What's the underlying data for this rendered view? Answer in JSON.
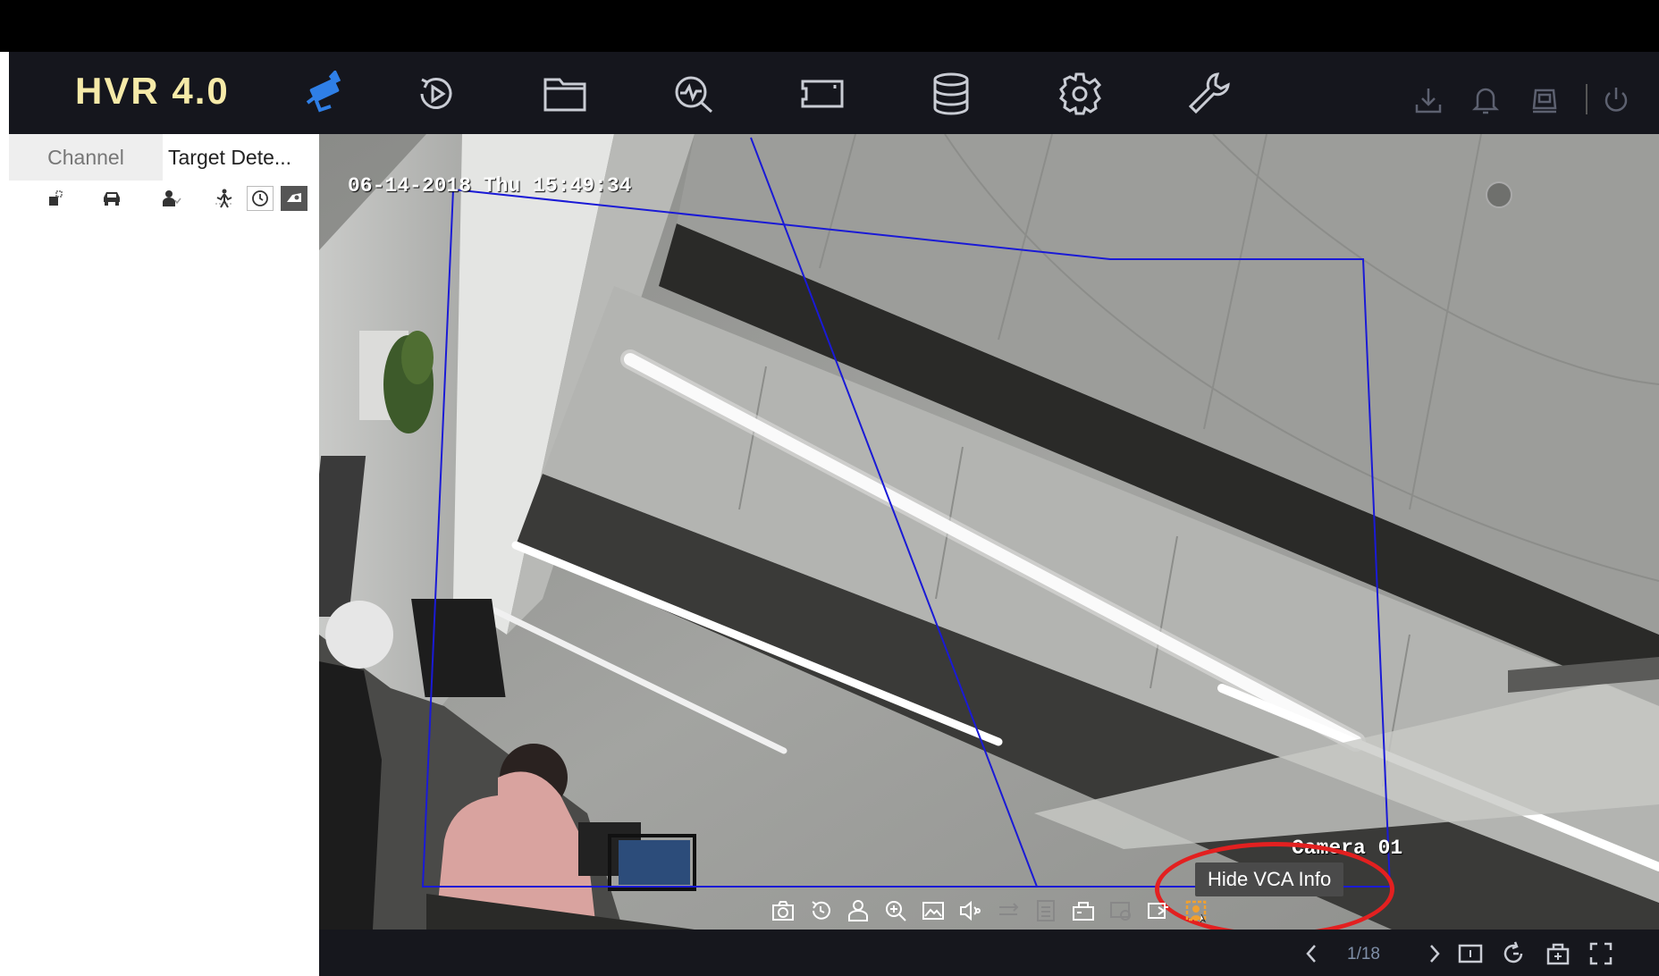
{
  "brand": {
    "title": "HVR 4.0",
    "color": "#f6eaa8"
  },
  "nav": {
    "items": [
      {
        "name": "live-view",
        "icon": "camera-icon",
        "active": true
      },
      {
        "name": "playback",
        "icon": "playback-icon"
      },
      {
        "name": "file-management",
        "icon": "folder-icon"
      },
      {
        "name": "smart-analysis",
        "icon": "search-waveform-icon"
      },
      {
        "name": "channel-management",
        "icon": "channel-frame-icon"
      },
      {
        "name": "storage",
        "icon": "database-icon"
      },
      {
        "name": "configuration",
        "icon": "gear-icon"
      },
      {
        "name": "maintenance",
        "icon": "wrench-icon"
      }
    ],
    "utilities": [
      {
        "name": "download",
        "icon": "download-icon"
      },
      {
        "name": "alarm",
        "icon": "bell-icon"
      },
      {
        "name": "exception",
        "icon": "monitor-icon"
      },
      {
        "name": "power",
        "icon": "power-icon"
      }
    ]
  },
  "left_panel": {
    "tabs": [
      {
        "label": "Channel",
        "active": false
      },
      {
        "label": "Target Dete...",
        "active": true
      }
    ],
    "filters": [
      {
        "icon": "all-targets-icon"
      },
      {
        "icon": "vehicle-icon"
      },
      {
        "icon": "person-icon"
      },
      {
        "icon": "intrusion-icon"
      },
      {
        "icon": "clock-icon",
        "selected": true
      },
      {
        "icon": "camera-icon",
        "selected": true
      }
    ]
  },
  "video": {
    "osd_time": "06-14-2018 Thu 15:49:34",
    "osd_camera": "Camera 01",
    "tooltip": "Hide VCA Info",
    "vca_line_color": "#1a1ad6",
    "highlight_color": "#e32020",
    "toolbar": [
      {
        "icon": "capture-icon"
      },
      {
        "icon": "instant-playback-icon"
      },
      {
        "icon": "person-icon"
      },
      {
        "icon": "digital-zoom-icon"
      },
      {
        "icon": "image-settings-icon"
      },
      {
        "icon": "audio-icon"
      },
      {
        "icon": "stream-switch-icon"
      },
      {
        "icon": "info-icon"
      },
      {
        "icon": "camera-ptz-icon"
      },
      {
        "icon": "fisheye-icon"
      },
      {
        "icon": "switch-output-icon"
      },
      {
        "icon": "vca-info-icon",
        "active": true
      }
    ]
  },
  "bottom_bar": {
    "page": "1/18"
  }
}
